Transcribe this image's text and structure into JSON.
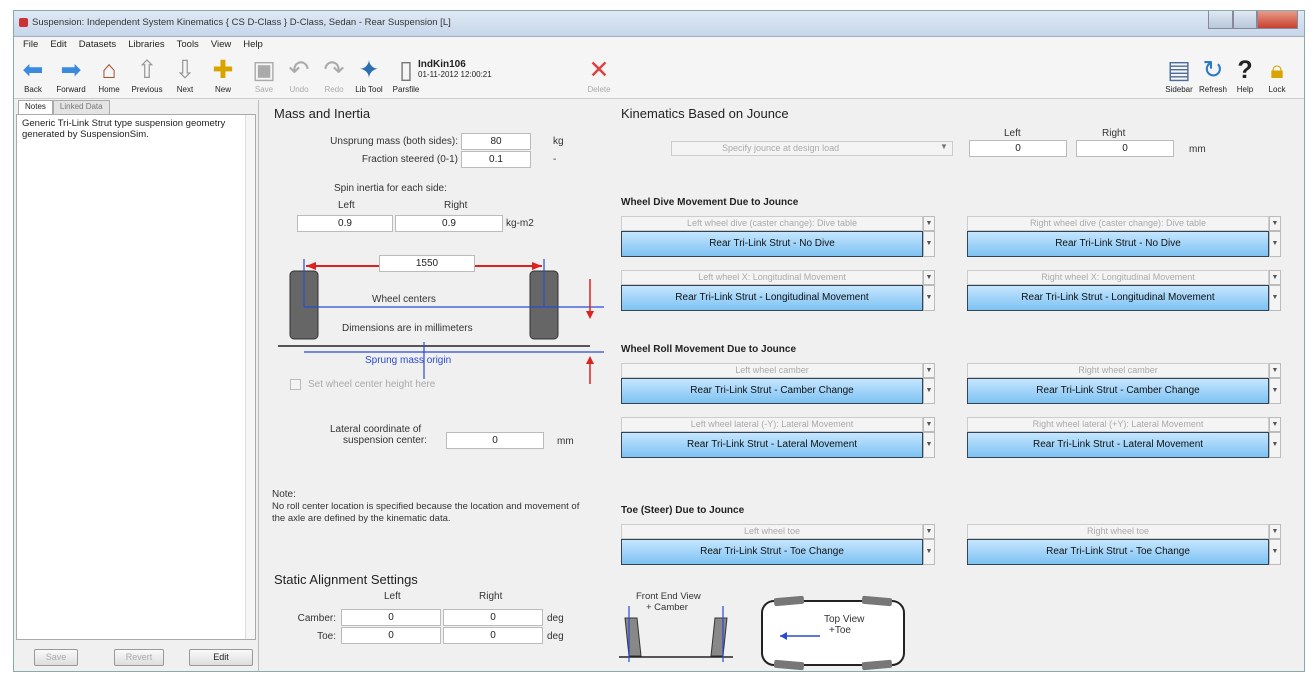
{
  "window": {
    "title": "Suspension: Independent System Kinematics   { CS D-Class }   D-Class, Sedan - Rear Suspension [L]"
  },
  "menu": [
    "File",
    "Edit",
    "Datasets",
    "Libraries",
    "Tools",
    "View",
    "Help"
  ],
  "toolbar": {
    "back": "Back",
    "forward": "Forward",
    "home": "Home",
    "previous": "Previous",
    "next": "Next",
    "new": "New",
    "save": "Save",
    "undo": "Undo",
    "redo": "Redo",
    "libtool": "Lib Tool",
    "parsfile": "Parsfile",
    "doc_name": "IndKin106",
    "doc_date": "01-11-2012 12:00:21",
    "delete": "Delete",
    "sidebar": "Sidebar",
    "refresh": "Refresh",
    "help": "Help",
    "lock": "Lock"
  },
  "tabs": [
    "Notes",
    "Linked Data"
  ],
  "notes": "Generic Tri-Link Strut type suspension geometry generated by SuspensionSim.",
  "left_buttons": {
    "save": "Save",
    "revert": "Revert",
    "edit": "Edit"
  },
  "mass": {
    "title": "Mass and Inertia",
    "unsprung_label": "Unsprung mass (both sides):",
    "unsprung_value": "80",
    "unsprung_unit": "kg",
    "fraction_label": "Fraction steered (0-1)",
    "fraction_value": "0.1",
    "fraction_unit": "-",
    "spin_label": "Spin inertia for each side:",
    "left": "Left",
    "right": "Right",
    "spin_left": "0.9",
    "spin_right": "0.9",
    "spin_unit": "kg-m2",
    "track_value": "1550",
    "wheel_centers": "Wheel centers",
    "dimensions_note": "Dimensions are in millimeters",
    "sprung_origin": "Sprung mass origin",
    "set_wheel_center": "Set wheel center height here",
    "lateral_label_1": "Lateral coordinate of",
    "lateral_label_2": "suspension center:",
    "lateral_value": "0",
    "lateral_unit": "mm",
    "note_title": "Note:",
    "note_text": "No roll center location is specified because the location and movement of the axle are defined by the kinematic data."
  },
  "static": {
    "title": "Static Alignment Settings",
    "left": "Left",
    "right": "Right",
    "camber": "Camber:",
    "camber_left": "0",
    "camber_right": "0",
    "camber_unit": "deg",
    "toe": "Toe:",
    "toe_left": "0",
    "toe_right": "0",
    "toe_unit": "deg"
  },
  "kin": {
    "title": "Kinematics Based on Jounce",
    "jounce_dd": "Specify jounce at design load",
    "left": "Left",
    "right": "Right",
    "jounce_left": "0",
    "jounce_right": "0",
    "jounce_unit": "mm"
  },
  "dive": {
    "title": "Wheel Dive Movement Due to Jounce",
    "l_dd": "Left wheel dive (caster change): Dive table",
    "l_val": "Rear Tri-Link Strut - No Dive",
    "r_dd": "Right wheel dive (caster change): Dive table",
    "r_val": "Rear Tri-Link Strut - No Dive",
    "lx_dd": "Left wheel X: Longitudinal Movement",
    "lx_val": "Rear Tri-Link Strut - Longitudinal Movement",
    "rx_dd": "Right wheel X: Longitudinal Movement",
    "rx_val": "Rear Tri-Link Strut - Longitudinal Movement"
  },
  "roll": {
    "title": "Wheel Roll Movement Due to Jounce",
    "l_dd": "Left wheel camber",
    "l_val": "Rear Tri-Link Strut - Camber Change",
    "r_dd": "Right wheel camber",
    "r_val": "Rear Tri-Link Strut - Camber Change",
    "ly_dd": "Left wheel lateral (-Y): Lateral Movement",
    "ly_val": "Rear Tri-Link Strut - Lateral Movement",
    "ry_dd": "Right wheel lateral (+Y): Lateral Movement",
    "ry_val": "Rear Tri-Link Strut - Lateral Movement"
  },
  "toe": {
    "title": "Toe (Steer) Due to Jounce",
    "l_dd": "Left wheel toe",
    "l_val": "Rear Tri-Link Strut - Toe Change",
    "r_dd": "Right wheel toe",
    "r_val": "Rear Tri-Link Strut - Toe Change"
  },
  "diagrams": {
    "front_1": "Front End View",
    "front_2": "+ Camber",
    "top_1": "Top View",
    "top_2": "+Toe"
  }
}
